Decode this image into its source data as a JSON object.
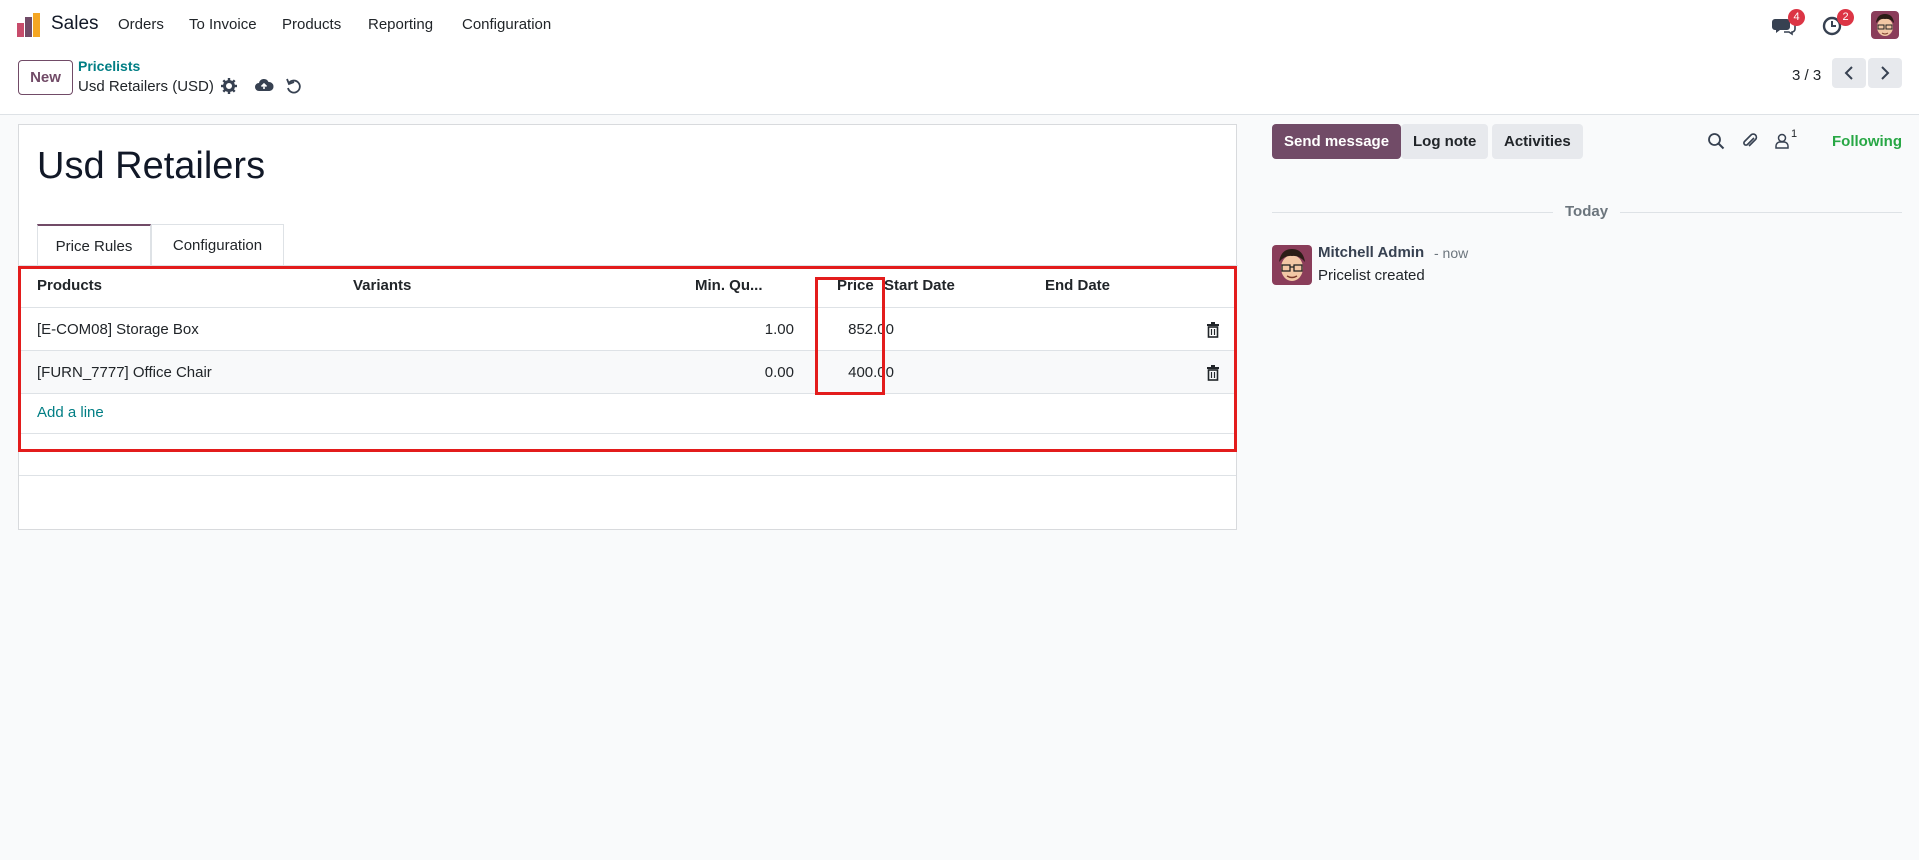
{
  "navbar": {
    "app_name": "Sales",
    "menu": [
      "Orders",
      "To Invoice",
      "Products",
      "Reporting",
      "Configuration"
    ],
    "messages_badge": "4",
    "activities_badge": "2"
  },
  "control_panel": {
    "new_label": "New",
    "breadcrumb_parent": "Pricelists",
    "breadcrumb_current": "Usd Retailers (USD)",
    "pager_value": "3 / 3"
  },
  "form": {
    "title": "Usd Retailers",
    "tabs": [
      "Price Rules",
      "Configuration"
    ],
    "columns": {
      "products": "Products",
      "variants": "Variants",
      "min_qty": "Min. Qu...",
      "price": "Price",
      "start_date": "Start Date",
      "end_date": "End Date"
    },
    "rows": [
      {
        "product": "[E-COM08] Storage Box",
        "variants": "",
        "min_qty": "1.00",
        "price": "852.00",
        "start_date": "",
        "end_date": ""
      },
      {
        "product": "[FURN_7777] Office Chair",
        "variants": "",
        "min_qty": "0.00",
        "price": "400.00",
        "start_date": "",
        "end_date": ""
      }
    ],
    "add_line_label": "Add a line"
  },
  "chatter": {
    "send_message_label": "Send message",
    "log_note_label": "Log note",
    "activities_label": "Activities",
    "followers_count": "1",
    "following_label": "Following",
    "date_separator": "Today",
    "message": {
      "author": "Mitchell Admin",
      "time": "- now",
      "body": "Pricelist created"
    }
  },
  "colors": {
    "brand": "#714b67",
    "link": "#017e84",
    "highlight_box": "#e31c1c",
    "following": "#28a745",
    "badge": "#dc3545"
  },
  "icons": [
    "app-logo-icon",
    "chat-icon",
    "clock-icon",
    "gear-icon",
    "cloud-upload-icon",
    "undo-icon",
    "chevron-left-icon",
    "chevron-right-icon",
    "trash-icon",
    "search-icon",
    "paperclip-icon",
    "user-icon"
  ]
}
